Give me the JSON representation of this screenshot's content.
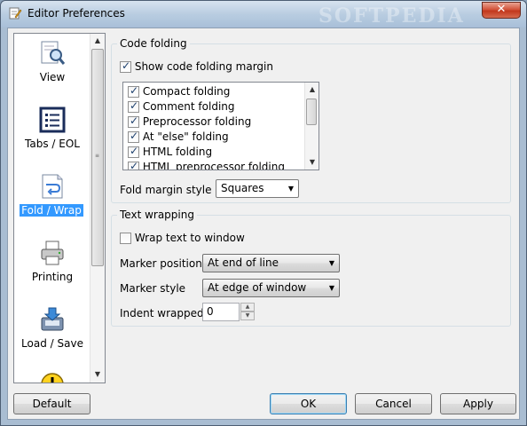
{
  "window": {
    "title": "Editor Preferences",
    "close_label": "✕",
    "watermark": "SOFTPEDIA"
  },
  "categories": [
    {
      "label": "View",
      "icon": "view-magnifier-icon",
      "selected": false
    },
    {
      "label": "Tabs / EOL",
      "icon": "tabs-eol-icon",
      "selected": false
    },
    {
      "label": "Fold / Wrap",
      "icon": "fold-wrap-icon",
      "selected": true
    },
    {
      "label": "Printing",
      "icon": "printer-icon",
      "selected": false
    },
    {
      "label": "Load / Save",
      "icon": "load-save-icon",
      "selected": false
    },
    {
      "label": "",
      "icon": "warning-icon",
      "selected": false
    }
  ],
  "code_folding": {
    "title": "Code folding",
    "show_margin_label": "Show code folding margin",
    "show_margin_checked": true,
    "fold_items": [
      {
        "label": "Compact folding",
        "checked": true
      },
      {
        "label": "Comment folding",
        "checked": true
      },
      {
        "label": "Preprocessor folding",
        "checked": true
      },
      {
        "label": "At \"else\" folding",
        "checked": true
      },
      {
        "label": "HTML folding",
        "checked": true
      },
      {
        "label": "HTML preprocessor folding",
        "checked": true
      }
    ],
    "fold_margin_style_label": "Fold margin style",
    "fold_margin_style_value": "Squares"
  },
  "text_wrapping": {
    "title": "Text wrapping",
    "wrap_label": "Wrap text to window",
    "wrap_checked": false,
    "marker_position_label": "Marker position",
    "marker_position_value": "At end of line",
    "marker_style_label": "Marker style",
    "marker_style_value": "At edge of window",
    "indent_wrapped_label": "Indent wrapped",
    "indent_wrapped_value": "0"
  },
  "buttons": {
    "default": "Default",
    "ok": "OK",
    "cancel": "Cancel",
    "apply": "Apply"
  },
  "colors": {
    "selection": "#3399ff",
    "close_button": "#c2381d"
  }
}
